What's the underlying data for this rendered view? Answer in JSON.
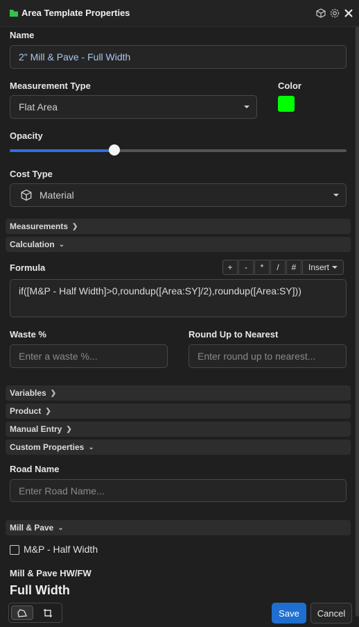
{
  "window": {
    "title": "Area Template Properties"
  },
  "name": {
    "label": "Name",
    "value": "2\" Mill & Pave - Full Width"
  },
  "measurement_type": {
    "label": "Measurement Type",
    "value": "Flat Area"
  },
  "color": {
    "label": "Color",
    "value": "#00ff00"
  },
  "opacity": {
    "label": "Opacity",
    "level_percent": 31
  },
  "cost_type": {
    "label": "Cost Type",
    "value": "Material",
    "icon": "cube-icon"
  },
  "sections": {
    "measurements": "Measurements",
    "calculation": "Calculation",
    "variables": "Variables",
    "product": "Product",
    "manual_entry": "Manual Entry",
    "custom_properties": "Custom Properties",
    "mill_pave": "Mill & Pave"
  },
  "formula": {
    "label": "Formula",
    "operators": [
      "+",
      "-",
      "*",
      "/",
      "#"
    ],
    "insert_label": "Insert",
    "value": "if([M&P - Half Width]>0,roundup([Area:SY]/2),roundup([Area:SY]))"
  },
  "waste": {
    "label": "Waste %",
    "placeholder": "Enter a waste %..."
  },
  "round_up": {
    "label": "Round Up to Nearest",
    "placeholder": "Enter round up to nearest..."
  },
  "road_name": {
    "label": "Road Name",
    "placeholder": "Enter Road Name..."
  },
  "mp_half_width": {
    "label": "M&P - Half Width",
    "checked": false
  },
  "mill_pave_hwfw": {
    "label": "Mill & Pave HW/FW",
    "value": "Full Width"
  },
  "footer": {
    "save_label": "Save",
    "cancel_label": "Cancel"
  }
}
